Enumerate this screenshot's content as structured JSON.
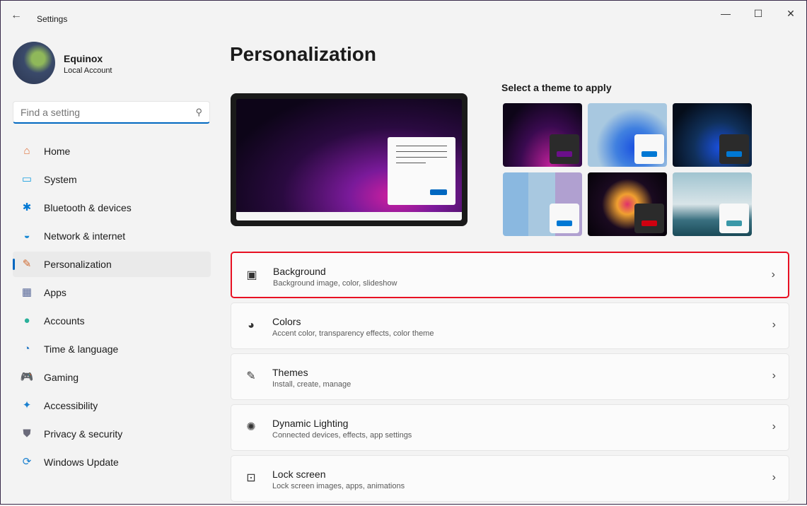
{
  "window": {
    "title": "Settings",
    "back": "←",
    "minimize": "—",
    "maximize": "☐",
    "close": "✕"
  },
  "user": {
    "name": "Equinox",
    "account_type": "Local Account"
  },
  "search": {
    "placeholder": "Find a setting",
    "value": ""
  },
  "sidebar": {
    "items": [
      {
        "label": "Home",
        "icon": "home-icon",
        "glyph": "⌂",
        "color": "#e0703a"
      },
      {
        "label": "System",
        "icon": "system-icon",
        "glyph": "▭",
        "color": "#1aa0e0"
      },
      {
        "label": "Bluetooth & devices",
        "icon": "bluetooth-icon",
        "glyph": "✱",
        "color": "#0078d4"
      },
      {
        "label": "Network & internet",
        "icon": "wifi-icon",
        "glyph": "◒",
        "color": "#1a8ad4"
      },
      {
        "label": "Personalization",
        "icon": "brush-icon",
        "glyph": "✎",
        "color": "#d06a30",
        "active": true
      },
      {
        "label": "Apps",
        "icon": "apps-icon",
        "glyph": "▦",
        "color": "#5a6a9a"
      },
      {
        "label": "Accounts",
        "icon": "accounts-icon",
        "glyph": "●",
        "color": "#2ab09a"
      },
      {
        "label": "Time & language",
        "icon": "clock-globe-icon",
        "glyph": "◔",
        "color": "#2a7ac4"
      },
      {
        "label": "Gaming",
        "icon": "gamepad-icon",
        "glyph": "🎮",
        "color": "#7a7a8a"
      },
      {
        "label": "Accessibility",
        "icon": "accessibility-icon",
        "glyph": "✦",
        "color": "#1a80d0"
      },
      {
        "label": "Privacy & security",
        "icon": "shield-icon",
        "glyph": "⛊",
        "color": "#6a6a7a"
      },
      {
        "label": "Windows Update",
        "icon": "update-icon",
        "glyph": "⟳",
        "color": "#1a80d0"
      }
    ]
  },
  "main": {
    "title": "Personalization",
    "theme_label": "Select a theme to apply",
    "themes": [
      {
        "bg": "radial-gradient(ellipse at 60% 100%,#c0209a,#3a0a50 45%,#0d0518 80%)",
        "box": "#2b2b2b",
        "accent": "#6b0f8a"
      },
      {
        "bg": "radial-gradient(circle at 60% 70%,#1a50e0,#4080e0 30%,#a8c8e0 60%)",
        "box": "#f8f8f8",
        "accent": "#0078d4"
      },
      {
        "bg": "radial-gradient(circle at 60% 70%,#1a50e0,#10305a 40%,#050d1a 80%)",
        "box": "#2b2b2b",
        "accent": "#0078d4"
      },
      {
        "bg": "linear-gradient(90deg,#8ab8e0 0 32%,#a8c8e0 32% 66%,#b0a0d0 66%)",
        "box": "#f8f8f8",
        "accent": "#0078d4"
      },
      {
        "bg": "radial-gradient(circle at 50% 50%,#e0306a,#f0a030 20%,#1a0a20 50%,#050208)",
        "box": "#2b2b2b",
        "accent": "#d00010"
      },
      {
        "bg": "linear-gradient(180deg,#a0c4d0 0,#d8e4e8 50%,#3a7080 75%,#1a4a58)",
        "box": "#f8f8f8",
        "accent": "#3a98a8"
      }
    ],
    "cards": [
      {
        "title": "Background",
        "subtitle": "Background image, color, slideshow",
        "icon": "image-icon",
        "glyph": "▣",
        "highlighted": true
      },
      {
        "title": "Colors",
        "subtitle": "Accent color, transparency effects, color theme",
        "icon": "palette-icon",
        "glyph": "◕"
      },
      {
        "title": "Themes",
        "subtitle": "Install, create, manage",
        "icon": "brush-icon",
        "glyph": "✎"
      },
      {
        "title": "Dynamic Lighting",
        "subtitle": "Connected devices, effects, app settings",
        "icon": "lighting-icon",
        "glyph": "✺"
      },
      {
        "title": "Lock screen",
        "subtitle": "Lock screen images, apps, animations",
        "icon": "lock-screen-icon",
        "glyph": "⊡"
      }
    ],
    "chevron": "›"
  },
  "colors": {
    "accent": "#0067c0",
    "highlight": "#e81123"
  }
}
